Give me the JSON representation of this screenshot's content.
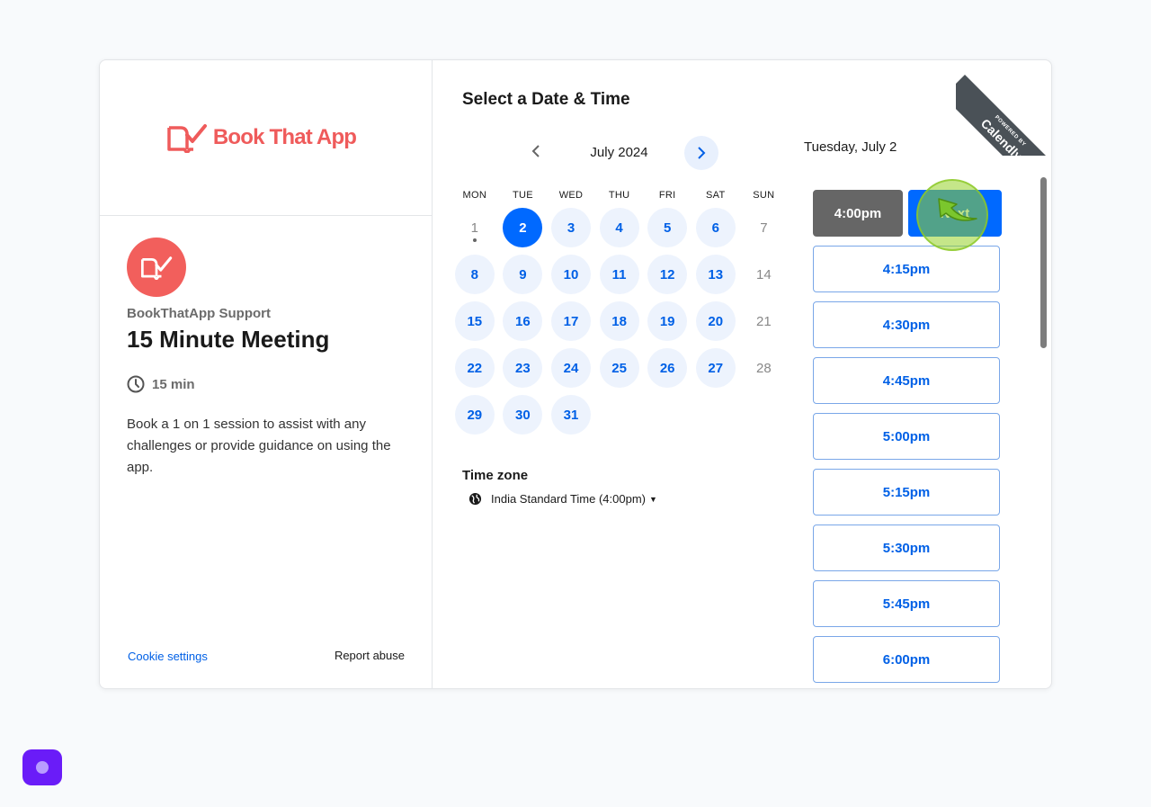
{
  "brand": {
    "logo_text": "Book That App",
    "accent": "#ef5b5b"
  },
  "event": {
    "host": "BookThatApp Support",
    "title": "15 Minute Meeting",
    "duration": "15 min",
    "description": "Book a 1 on 1 session to assist with any challenges or provide guidance on using the app."
  },
  "footer": {
    "cookie_label": "Cookie settings",
    "report_label": "Report abuse"
  },
  "scheduler": {
    "heading": "Select a Date & Time",
    "month_label": "July 2024",
    "weekdays": [
      "MON",
      "TUE",
      "WED",
      "THU",
      "FRI",
      "SAT",
      "SUN"
    ],
    "days": [
      {
        "n": "1",
        "state": "dis",
        "dot": true
      },
      {
        "n": "2",
        "state": "sel"
      },
      {
        "n": "3",
        "state": "avail"
      },
      {
        "n": "4",
        "state": "avail"
      },
      {
        "n": "5",
        "state": "avail"
      },
      {
        "n": "6",
        "state": "avail"
      },
      {
        "n": "7",
        "state": "dis"
      },
      {
        "n": "8",
        "state": "avail"
      },
      {
        "n": "9",
        "state": "avail"
      },
      {
        "n": "10",
        "state": "avail"
      },
      {
        "n": "11",
        "state": "avail"
      },
      {
        "n": "12",
        "state": "avail"
      },
      {
        "n": "13",
        "state": "avail"
      },
      {
        "n": "14",
        "state": "dis"
      },
      {
        "n": "15",
        "state": "avail"
      },
      {
        "n": "16",
        "state": "avail"
      },
      {
        "n": "17",
        "state": "avail"
      },
      {
        "n": "18",
        "state": "avail"
      },
      {
        "n": "19",
        "state": "avail"
      },
      {
        "n": "20",
        "state": "avail"
      },
      {
        "n": "21",
        "state": "dis"
      },
      {
        "n": "22",
        "state": "avail"
      },
      {
        "n": "23",
        "state": "avail"
      },
      {
        "n": "24",
        "state": "avail"
      },
      {
        "n": "25",
        "state": "avail"
      },
      {
        "n": "26",
        "state": "avail"
      },
      {
        "n": "27",
        "state": "avail"
      },
      {
        "n": "28",
        "state": "dis"
      },
      {
        "n": "29",
        "state": "avail"
      },
      {
        "n": "30",
        "state": "avail"
      },
      {
        "n": "31",
        "state": "avail"
      }
    ],
    "timezone_label": "Time zone",
    "timezone_value": "India Standard Time (4:00pm)",
    "selected_date_label": "Tuesday, July 2",
    "selected_slot": "4:00pm",
    "next_label": "Next",
    "slots": [
      "4:15pm",
      "4:30pm",
      "4:45pm",
      "5:00pm",
      "5:15pm",
      "5:30pm",
      "5:45pm",
      "6:00pm"
    ]
  },
  "ribbon": {
    "small": "POWERED BY",
    "big": "Calendly"
  }
}
